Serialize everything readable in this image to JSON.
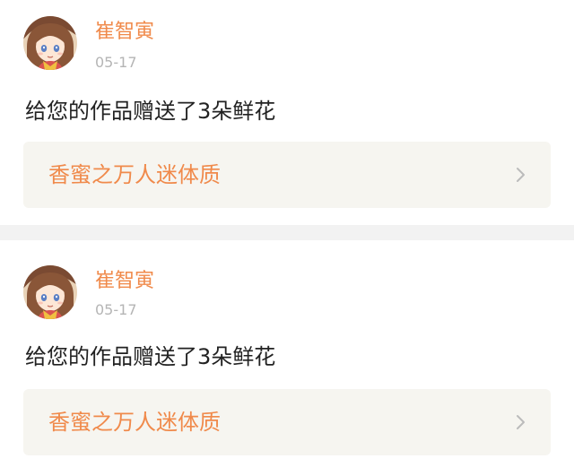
{
  "notifications": [
    {
      "username": "崔智寅",
      "date": "05-17",
      "message": "给您的作品赠送了3朵鲜花",
      "work_title": "香蜜之万人迷体质",
      "avatar_icon": "anime-girl-avatar",
      "chevron_icon": "chevron-right-icon"
    },
    {
      "username": "崔智寅",
      "date": "05-17",
      "message": "给您的作品赠送了3朵鲜花",
      "work_title": "香蜜之万人迷体质",
      "avatar_icon": "anime-girl-avatar",
      "chevron_icon": "chevron-right-icon"
    }
  ],
  "colors": {
    "accent": "#f08a4b",
    "date_gray": "#b5b5b5",
    "text": "#222222",
    "link_bg": "#f6f5f0",
    "separator_bg": "#f2f2f2"
  }
}
